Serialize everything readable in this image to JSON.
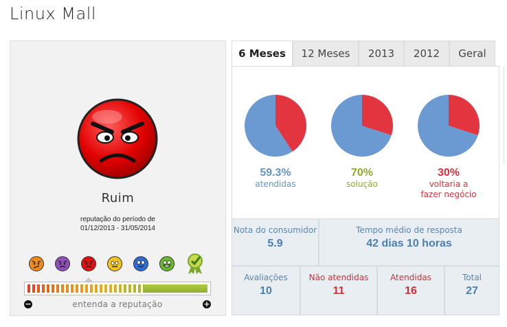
{
  "store": {
    "title": "Linux Mall"
  },
  "reputation": {
    "label": "Ruim",
    "period_caption": "reputação do período de",
    "period_range": "01/12/2013 - 31/05/2014",
    "understand_link": "entenda a reputação",
    "scale": [
      "terrible-face-icon",
      "bad-face-icon",
      "angry-face-icon",
      "neutral-face-icon",
      "good-face-icon",
      "great-face-icon",
      "award-badge-icon"
    ],
    "current_index": 2
  },
  "tabs": [
    {
      "label": "6 Meses",
      "active": true
    },
    {
      "label": "12 Meses",
      "active": false
    },
    {
      "label": "2013",
      "active": false
    },
    {
      "label": "2012",
      "active": false
    },
    {
      "label": "Geral",
      "active": false
    }
  ],
  "metrics": {
    "atendidas": {
      "value": "59.3%",
      "label": "atendidas",
      "fraction": 0.593,
      "color": "#6495c8"
    },
    "solucao": {
      "value": "70%",
      "label": "solução",
      "fraction": 0.7,
      "color": "#8faa2a"
    },
    "voltaria": {
      "value": "30%",
      "label_line1": "voltaria a",
      "label_line2": "fazer negócio",
      "fraction": 0.3,
      "color": "#e0303a"
    }
  },
  "pie_colors": {
    "blue": "#6a9ad1",
    "red": "#e23540"
  },
  "stats": {
    "nota_label": "Nota do consumidor",
    "nota_value": "5.9",
    "tempo_label": "Tempo médio de resposta",
    "tempo_value": "42 dias 10 horas",
    "avaliacoes_label": "Avaliações",
    "avaliacoes_value": "10",
    "nao_atendidas_label": "Não atendidas",
    "nao_atendidas_value": "11",
    "atendidas_label": "Atendidas",
    "atendidas_value": "16",
    "total_label": "Total",
    "total_value": "27"
  }
}
